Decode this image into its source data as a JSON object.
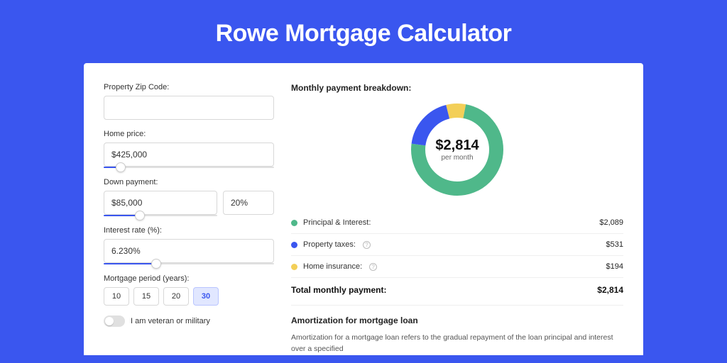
{
  "title": "Rowe Mortgage Calculator",
  "colors": {
    "principal": "#4fb88a",
    "taxes": "#3a56ef",
    "insurance": "#f3cf58"
  },
  "form": {
    "zip_label": "Property Zip Code:",
    "zip_value": "",
    "home_price_label": "Home price:",
    "home_price_value": "$425,000",
    "down_label": "Down payment:",
    "down_value": "$85,000",
    "down_pct": "20%",
    "rate_label": "Interest rate (%):",
    "rate_value": "6.230%",
    "period_label": "Mortgage period (years):",
    "periods": [
      "10",
      "15",
      "20",
      "30"
    ],
    "period_selected": "30",
    "veteran_label": "I am veteran or military"
  },
  "breakdown": {
    "heading": "Monthly payment breakdown:",
    "center_amount": "$2,814",
    "center_sub": "per month",
    "items": [
      {
        "key": "principal",
        "label": "Principal & Interest:",
        "value": "$2,089",
        "info": false,
        "pct": 74
      },
      {
        "key": "taxes",
        "label": "Property taxes:",
        "value": "$531",
        "info": true,
        "pct": 19
      },
      {
        "key": "insurance",
        "label": "Home insurance:",
        "value": "$194",
        "info": true,
        "pct": 7
      }
    ],
    "total_label": "Total monthly payment:",
    "total_value": "$2,814"
  },
  "amort": {
    "title": "Amortization for mortgage loan",
    "text": "Amortization for a mortgage loan refers to the gradual repayment of the loan principal and interest over a specified"
  }
}
